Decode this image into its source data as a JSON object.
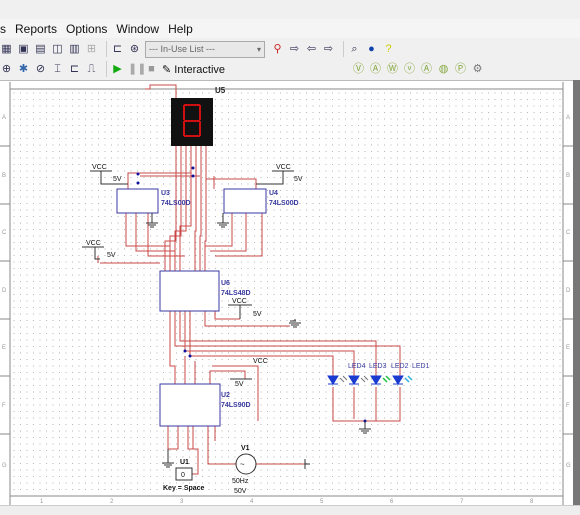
{
  "menu": {
    "items": [
      {
        "label": "s"
      },
      {
        "label": "Reports"
      },
      {
        "label": "Options"
      },
      {
        "label": "Window"
      },
      {
        "label": "Help"
      }
    ]
  },
  "toolbar1": {
    "inuse_list": "--- In-Use List ---"
  },
  "toolbar2": {
    "mode_label": "Interactive"
  },
  "schematic": {
    "border_rows": [
      "A",
      "B",
      "C",
      "D",
      "E",
      "F",
      "G"
    ],
    "border_cols": [
      "1",
      "2",
      "3",
      "4",
      "5",
      "6",
      "7",
      "8"
    ],
    "components": {
      "u5": {
        "ref": "U5"
      },
      "u3": {
        "ref": "U3",
        "part": "74LS00D"
      },
      "u4": {
        "ref": "U4",
        "part": "74LS00D"
      },
      "u6": {
        "ref": "U6",
        "part": "74LS48D"
      },
      "u2": {
        "ref": "U2",
        "part": "74LS90D"
      },
      "u1": {
        "ref": "U1",
        "value": "0",
        "key": "Key = Space"
      },
      "v1": {
        "ref": "V1",
        "symbol": "~",
        "freq": "50Hz",
        "amp": "50V"
      },
      "leds": [
        "LED4",
        "LED3",
        "LED2",
        "LED1"
      ]
    },
    "power": {
      "vcc": "VCC",
      "v": "5V"
    },
    "colors": {
      "wire": "#c84848",
      "part": "#3a3aa0",
      "led_blue": "#1a3ad0",
      "led_green": "#20c040",
      "led_cyan": "#30b0e0",
      "segment": "#d01010"
    }
  }
}
